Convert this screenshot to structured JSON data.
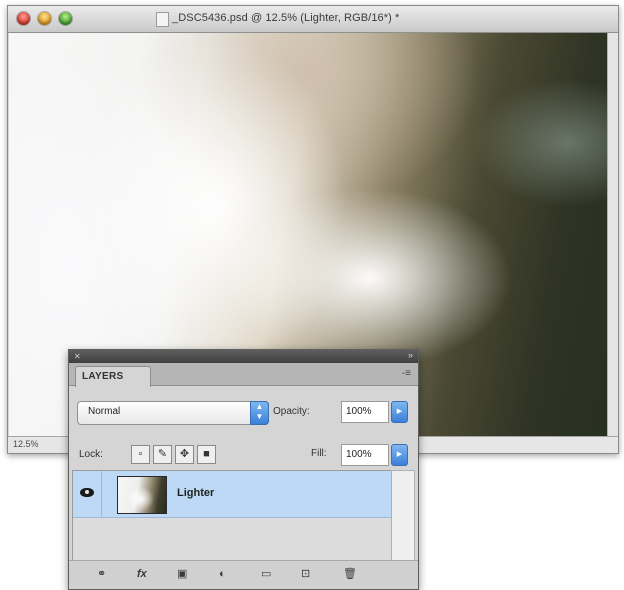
{
  "document_window": {
    "title": "_DSC5436.psd @ 12.5% (Lighter, RGB/16*) *",
    "zoom": "12.5%"
  },
  "layers_panel": {
    "tab_label": "LAYERS",
    "menu_icon": "-≡",
    "blend_mode": "Normal",
    "opacity_label": "Opacity:",
    "opacity_value": "100%",
    "lock_label": "Lock:",
    "fill_label": "Fill:",
    "fill_value": "100%",
    "layers": [
      {
        "name": "Lighter",
        "visible": true,
        "selected": true
      }
    ],
    "footer_icons": [
      "link-icon",
      "fx-icon",
      "mask-icon",
      "adjustment-icon",
      "group-icon",
      "new-layer-icon",
      "trash-icon"
    ]
  },
  "colors": {
    "selection": "#bdd9f5",
    "accent": "#3a7fd8"
  }
}
